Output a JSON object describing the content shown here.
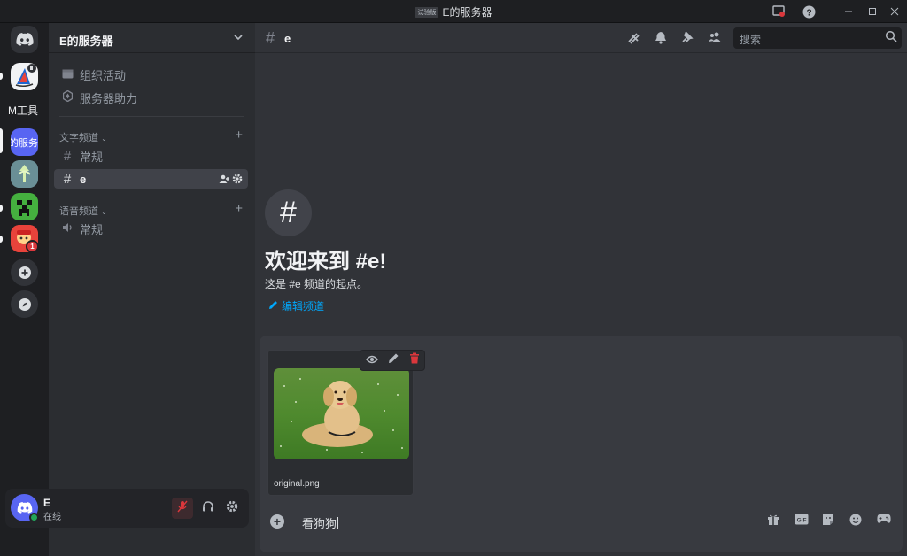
{
  "window": {
    "title": "E的服务器",
    "title_tag": "试验版"
  },
  "rail": {
    "servers": [
      {
        "name": "discord-home",
        "label": ""
      },
      {
        "name": "mj-server",
        "label": ""
      },
      {
        "name": "m-tools-server",
        "label": "M工具"
      },
      {
        "name": "e-server",
        "label": "的服务器"
      },
      {
        "name": "tree-server",
        "label": ""
      },
      {
        "name": "creeper-server",
        "label": ""
      },
      {
        "name": "mascot-server",
        "label": "",
        "badge": "1"
      }
    ]
  },
  "sidebar": {
    "guild_name": "E的服务器",
    "top_items": [
      {
        "label": "组织活动"
      },
      {
        "label": "服务器助力"
      }
    ],
    "text_category": "文字频道",
    "text_channels": [
      {
        "label": "常规"
      },
      {
        "label": "e"
      }
    ],
    "voice_category": "语音频道",
    "voice_channels": [
      {
        "label": "常规"
      }
    ]
  },
  "user": {
    "name": "E",
    "status": "在线"
  },
  "header": {
    "channel_name": "e",
    "search_placeholder": "搜索"
  },
  "welcome": {
    "title": "欢迎来到 #e!",
    "subtitle": "这是 #e 频道的起点。",
    "edit_label": "编辑频道"
  },
  "composer": {
    "attachment_name": "original.png",
    "text": "看狗狗"
  },
  "colors": {
    "accent": "#5865f2",
    "link": "#00a8fc",
    "danger": "#da373c",
    "online": "#23a55a"
  }
}
